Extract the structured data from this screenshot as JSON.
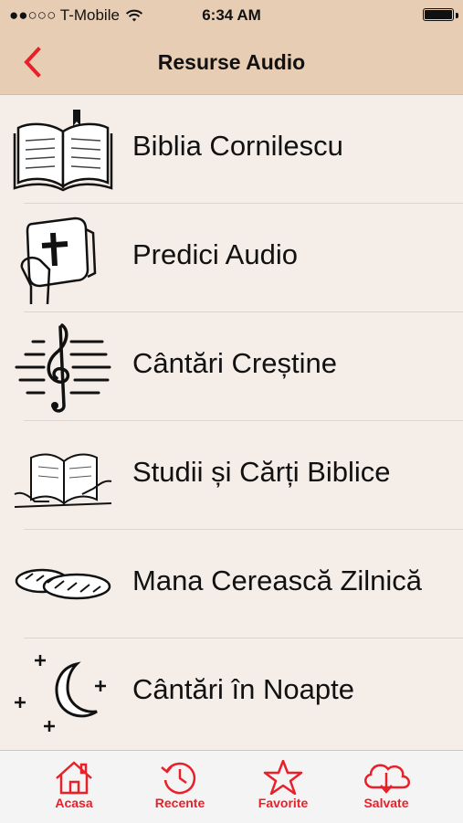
{
  "status": {
    "carrier": "●●○○○ T-Mobile",
    "time": "6:34 AM"
  },
  "header": {
    "title": "Resurse Audio",
    "back_icon": "chevron-left-icon"
  },
  "accent_color": "#e8202a",
  "items": [
    {
      "label": "Biblia Cornilescu",
      "icon": "open-bible-icon"
    },
    {
      "label": "Predici Audio",
      "icon": "hand-holding-bible-icon"
    },
    {
      "label": "Cântări Creștine",
      "icon": "treble-clef-icon"
    },
    {
      "label": "Studii și Cărți Biblice",
      "icon": "reading-book-icon"
    },
    {
      "label": "Mana Cerească Zilnică",
      "icon": "bread-loaves-icon"
    },
    {
      "label": "Cântări în Noapte",
      "icon": "moon-stars-icon"
    }
  ],
  "tabs": [
    {
      "label": "Acasa",
      "icon": "home-icon"
    },
    {
      "label": "Recente",
      "icon": "history-clock-icon"
    },
    {
      "label": "Favorite",
      "icon": "star-icon"
    },
    {
      "label": "Salvate",
      "icon": "cloud-download-icon"
    }
  ]
}
